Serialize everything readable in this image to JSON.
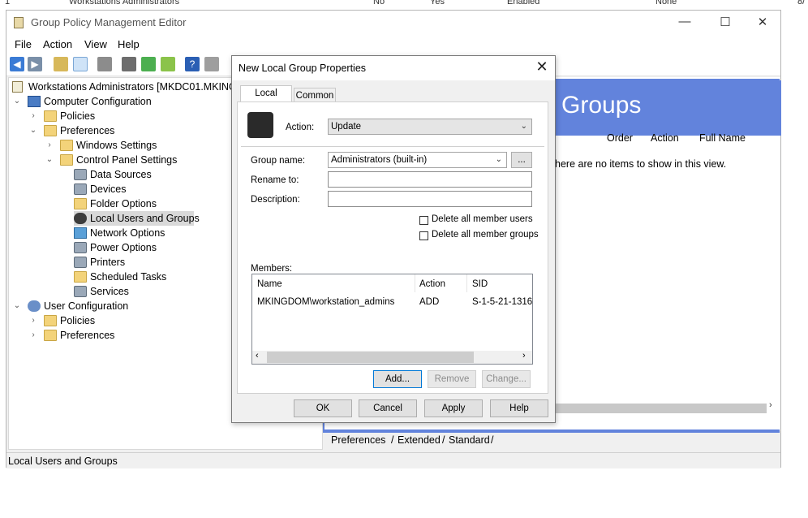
{
  "background": {
    "row_fragments": [
      "1",
      "Workstations Administrators",
      "No",
      "Yes",
      "Enabled",
      "None",
      "8/"
    ]
  },
  "window": {
    "title": "Group Policy Management Editor",
    "controls": {
      "minimize": "—",
      "maximize": "☐",
      "close": "✕"
    }
  },
  "menu": [
    "File",
    "Action",
    "View",
    "Help"
  ],
  "tree": {
    "root": "Workstations Administrators [MKDC01.MKINGDOM",
    "computer_config": "Computer Configuration",
    "policies": "Policies",
    "preferences": "Preferences",
    "windows_settings": "Windows Settings",
    "control_panel": "Control Panel Settings",
    "items": [
      "Data Sources",
      "Devices",
      "Folder Options",
      "Local Users and Groups",
      "Network Options",
      "Power Options",
      "Printers",
      "Scheduled Tasks",
      "Services"
    ],
    "user_config": "User Configuration",
    "user_policies": "Policies",
    "user_preferences": "Preferences"
  },
  "right_pane": {
    "title": "Groups",
    "columns": [
      "Order",
      "Action",
      "Full Name"
    ],
    "empty_text": "here are no items to show in this view.",
    "tabs": [
      "Preferences",
      "Extended",
      "Standard"
    ]
  },
  "status": "Local Users and Groups",
  "dialog": {
    "title": "New Local Group Properties",
    "tabs": [
      "Local Group",
      "Common"
    ],
    "action_label": "Action:",
    "action_value": "Update",
    "group_name_label": "Group name:",
    "group_name_value": "Administrators (built-in)",
    "browse_label": "...",
    "rename_label": "Rename to:",
    "description_label": "Description:",
    "delete_users": "Delete all member users",
    "delete_groups": "Delete all member groups",
    "members_label": "Members:",
    "member_columns": [
      "Name",
      "Action",
      "SID"
    ],
    "members": [
      {
        "name": "MKINGDOM\\workstation_admins",
        "action": "ADD",
        "sid": "S-1-5-21-1316:"
      }
    ],
    "buttons": {
      "add": "Add...",
      "remove": "Remove",
      "change": "Change...",
      "ok": "OK",
      "cancel": "Cancel",
      "apply": "Apply",
      "help": "Help"
    }
  }
}
